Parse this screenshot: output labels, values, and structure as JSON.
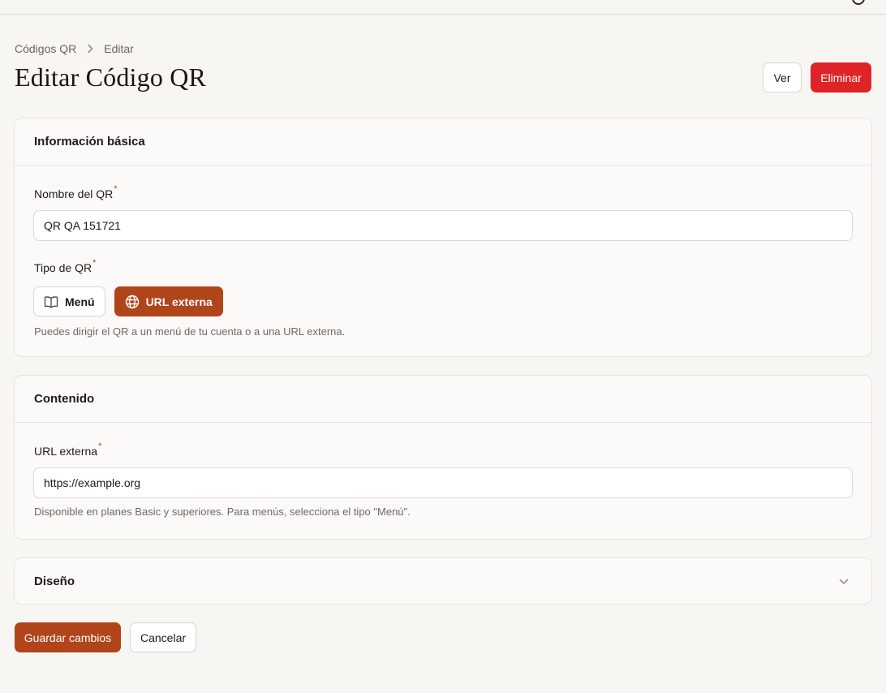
{
  "breadcrumb": {
    "parent": "Códigos QR",
    "current": "Editar"
  },
  "header": {
    "title": "Editar Código QR",
    "view_label": "Ver",
    "delete_label": "Eliminar"
  },
  "basic_info": {
    "title": "Información básica",
    "name_label": "Nombre del QR",
    "name_value": "QR QA 151721",
    "type_label": "Tipo de QR",
    "type_options": [
      {
        "label": "Menú",
        "icon": "book-icon",
        "selected": false
      },
      {
        "label": "URL externa",
        "icon": "globe-icon",
        "selected": true
      }
    ],
    "type_help": "Puedes dirigir el QR a un menú de tu cuenta o a una URL externa."
  },
  "content": {
    "title": "Contenido",
    "url_label": "URL externa",
    "url_value": "https://example.org",
    "url_help": "Disponible en planes Basic y superiores. Para menús, selecciona el tipo \"Menú\"."
  },
  "design": {
    "title": "Diseño",
    "icon": "chevron-down-icon"
  },
  "actions": {
    "save_label": "Guardar cambios",
    "cancel_label": "Cancelar"
  },
  "required_mark": "*",
  "colors": {
    "primary": "#b0441a",
    "danger": "#df2428",
    "background": "#f8f6f2"
  }
}
